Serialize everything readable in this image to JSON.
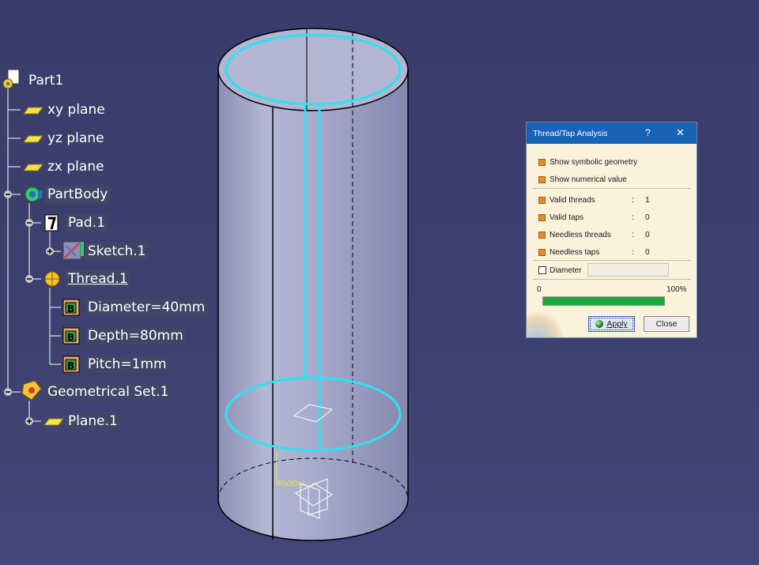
{
  "tree": {
    "root": "Part1",
    "items": [
      {
        "label": "xy plane"
      },
      {
        "label": "yz plane"
      },
      {
        "label": "zx plane"
      },
      {
        "label": "PartBody"
      },
      {
        "label": "Pad.1"
      },
      {
        "label": "Sketch.1"
      },
      {
        "label": "Thread.1"
      },
      {
        "label": "Diameter=40mm"
      },
      {
        "label": "Depth=80mm"
      },
      {
        "label": "Pitch=1mm"
      },
      {
        "label": "Geometrical Set.1"
      },
      {
        "label": "Plane.1"
      }
    ]
  },
  "model": {
    "thread_annotation": "40x80x1"
  },
  "dialog": {
    "title": "Thread/Tap Analysis",
    "help": "?",
    "close_glyph": "✕",
    "show_symbolic": "Show symbolic geometry",
    "show_numerical": "Show numerical value",
    "rows": [
      {
        "label": "Valid threads",
        "colon": ":",
        "value": "1"
      },
      {
        "label": "Valid taps",
        "colon": ":",
        "value": "0"
      },
      {
        "label": "Needless threads",
        "colon": ":",
        "value": "0"
      },
      {
        "label": "Needless taps",
        "colon": ":",
        "value": "0"
      }
    ],
    "diameter_label": "Diameter",
    "progress_min": "0",
    "progress_max": "100%",
    "progress_value": 1.0,
    "apply": "Apply",
    "close": "Close"
  },
  "colors": {
    "background": "#3e416f",
    "highlight": "#27e4ef",
    "titlebar": "#1862b7",
    "progress": "#1aa83a",
    "annotation": "#e8e84a"
  }
}
